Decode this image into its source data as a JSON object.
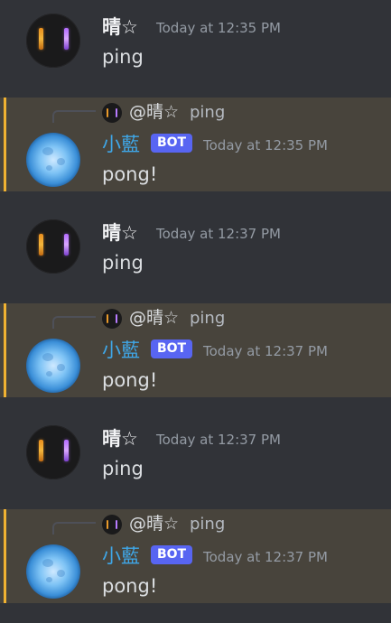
{
  "colors": {
    "background": "#313338",
    "highlight": "#48443c",
    "highlight_bar": "#f0b232",
    "bot_name": "#3fa7e8",
    "bot_badge": "#5865f2",
    "timestamp": "#949ba4"
  },
  "messages": [
    {
      "author": "晴☆",
      "time": "Today at 12:35 PM",
      "text": "ping",
      "avatar": "glowing-bars-avatar"
    },
    {
      "reply": {
        "author": "@晴☆",
        "text": "ping"
      },
      "author": "小藍",
      "badge": "BOT",
      "time": "Today at 12:35 PM",
      "text": "pong!",
      "avatar": "blue-moon-avatar"
    },
    {
      "author": "晴☆",
      "time": "Today at 12:37 PM",
      "text": "ping",
      "avatar": "glowing-bars-avatar"
    },
    {
      "reply": {
        "author": "@晴☆",
        "text": "ping"
      },
      "author": "小藍",
      "badge": "BOT",
      "time": "Today at 12:37 PM",
      "text": "pong!",
      "avatar": "blue-moon-avatar"
    },
    {
      "author": "晴☆",
      "time": "Today at 12:37 PM",
      "text": "ping",
      "avatar": "glowing-bars-avatar"
    },
    {
      "reply": {
        "author": "@晴☆",
        "text": "ping"
      },
      "author": "小藍",
      "badge": "BOT",
      "time": "Today at 12:37 PM",
      "text": "pong!",
      "avatar": "blue-moon-avatar"
    }
  ]
}
